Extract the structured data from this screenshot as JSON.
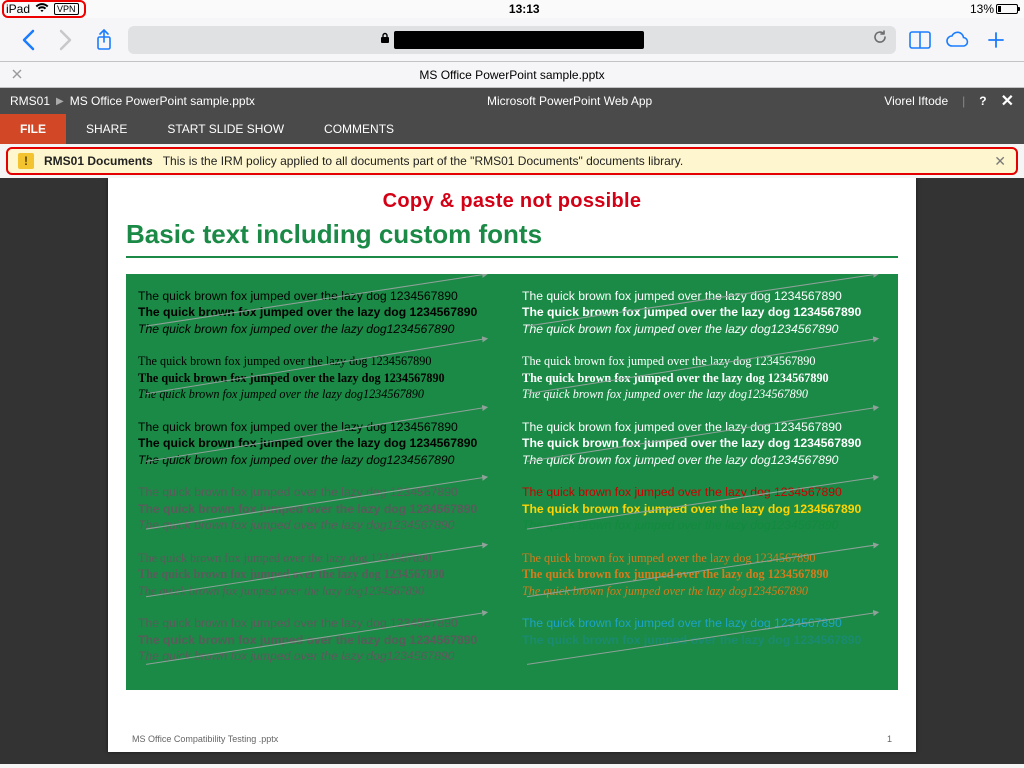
{
  "status": {
    "device": "iPad",
    "wifi_glyph": "▲",
    "vpn": "VPN",
    "time": "13:13",
    "battery_pct": "13%"
  },
  "safari": {
    "tab_title": "MS Office PowerPoint sample.pptx"
  },
  "pp_header": {
    "breadcrumb_root": "RMS01",
    "breadcrumb_file": "MS Office PowerPoint sample.pptx",
    "app_title": "Microsoft PowerPoint Web App",
    "username": "Viorel Iftode"
  },
  "pp_tabs": {
    "file": "FILE",
    "share": "SHARE",
    "startshow": "START SLIDE SHOW",
    "comments": "COMMENTS"
  },
  "irm": {
    "policy_name": "RMS01 Documents",
    "policy_text": "This is the IRM policy applied to all documents part of the \"RMS01 Documents\" documents library."
  },
  "annotation": "Copy & paste not possible",
  "slide": {
    "title": "Basic text including custom fonts",
    "sample_line": "The quick brown fox jumped over the lazy dog 1234567890",
    "sample_line_nospace": "The quick brown fox jumped over the lazy dog1234567890",
    "footer_left": "MS Office Compatibility Testing .pptx",
    "footer_right": "1"
  }
}
